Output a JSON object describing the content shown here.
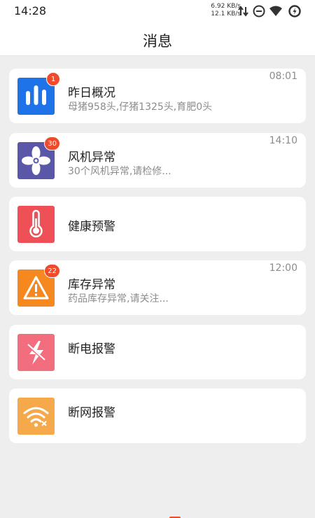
{
  "status_bar": {
    "time": "14:28",
    "speed_up": "6.92 KB/s",
    "speed_down": "12.1 KB/s",
    "icons": [
      "data-transfer-icon",
      "do-not-disturb-icon",
      "wifi-icon",
      "battery-saver-icon"
    ]
  },
  "header": {
    "title": "消息"
  },
  "messages": [
    {
      "title": "昨日概况",
      "subtitle": "母猪958头,仔猪1325头,育肥0头",
      "time": "08:01",
      "badge": "1",
      "icon": "bar-chart-icon",
      "color": "#1f73e8"
    },
    {
      "title": "风机异常",
      "subtitle": "30个风机异常,请检修...",
      "time": "14:10",
      "badge": "30",
      "icon": "fan-icon",
      "color": "#5a56a8"
    },
    {
      "title": "健康预警",
      "subtitle": "",
      "time": "",
      "badge": "",
      "icon": "thermometer-icon",
      "color": "#ef4f56"
    },
    {
      "title": "库存异常",
      "subtitle": "药品库存异常,请关注...",
      "time": "12:00",
      "badge": "22",
      "icon": "warning-icon",
      "color": "#f5891f"
    },
    {
      "title": "断电报警",
      "subtitle": "",
      "time": "",
      "badge": "",
      "icon": "power-off-icon",
      "color": "#f26e7e"
    },
    {
      "title": "断网报警",
      "subtitle": "",
      "time": "",
      "badge": "",
      "icon": "wifi-off-icon",
      "color": "#f5a94b"
    }
  ]
}
